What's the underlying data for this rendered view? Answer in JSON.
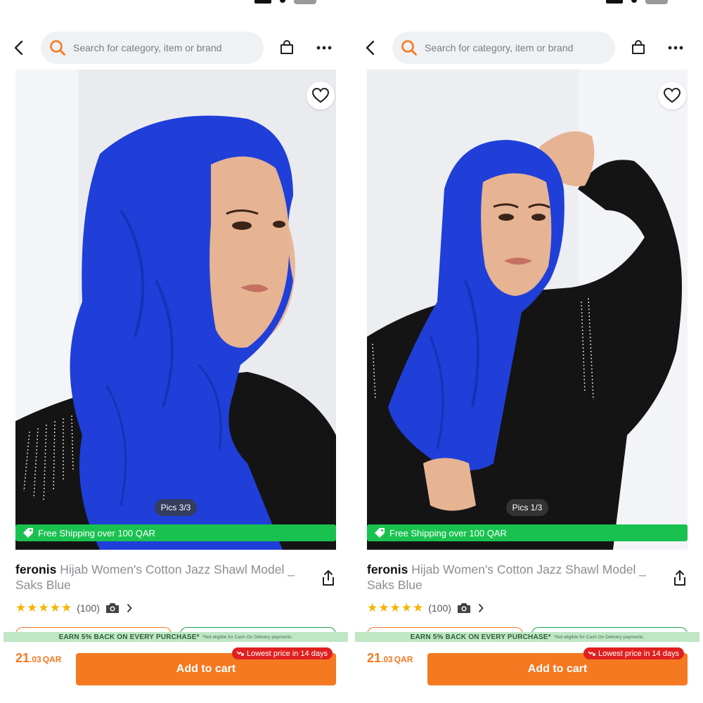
{
  "search": {
    "placeholder": "Search for category, item or brand"
  },
  "product": {
    "brand": "feronis",
    "name": "Hijab Women's Cotton Jazz Shawl Model _ Saks Blue",
    "rating_stars": "★★★★★",
    "rating_count": "(100)",
    "rating_value": 5,
    "free_shipping": "Free Shipping over 100 QAR",
    "earn_text": "EARN 5% BACK ON EVERY PURCHASE*",
    "earn_note": "*Not eligible for Cash On Delivery payments.",
    "price_int": "21",
    "price_dec": ".03",
    "currency": "QAR",
    "lowest_badge": "Lowest price in 14 days",
    "add_to_cart": "Add to cart"
  },
  "screens": [
    {
      "pics_label": "Pics 3/3"
    },
    {
      "pics_label": "Pics 1/3"
    }
  ],
  "colors": {
    "accent_orange": "#f47920",
    "shipping_green": "#19c24f",
    "badge_red": "#e02020",
    "star_yellow": "#f4b400",
    "hijab_blue": "#1f3fd8"
  }
}
